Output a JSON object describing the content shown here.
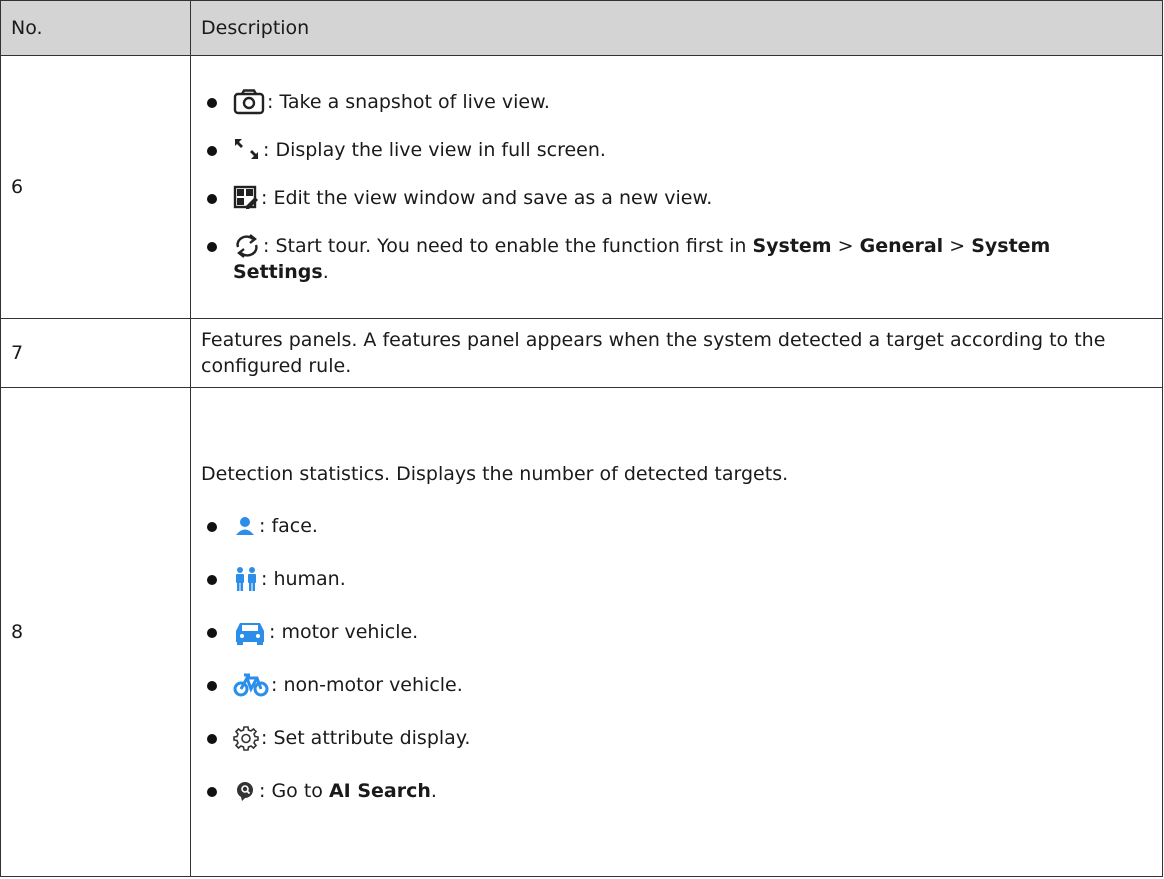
{
  "header": {
    "col_no": "No.",
    "col_desc": "Description"
  },
  "rows": {
    "r6": {
      "no": "6",
      "items": [
        {
          "icon": "camera-snapshot-icon",
          "text": ": Take a snapshot of live view."
        },
        {
          "icon": "fullscreen-icon",
          "text": ": Display the live view in full screen."
        },
        {
          "icon": "edit-view-window-icon",
          "text": ": Edit the view window and save as a new view."
        },
        {
          "icon": "tour-refresh-icon",
          "text_a": ": Start tour. You need to enable the function first in ",
          "b1": "System",
          "sep1": "  > ",
          "b2": "General",
          "sep2": " > ",
          "b3": "System Settings",
          "end": "."
        }
      ]
    },
    "r7": {
      "no": "7",
      "text": "Features panels. A features panel appears when the system detected a target according to the configured rule."
    },
    "r8": {
      "no": "8",
      "intro": "Detection statistics. Displays the number of detected targets.",
      "items": [
        {
          "icon": "face-icon",
          "text": ": face."
        },
        {
          "icon": "human-icon",
          "text": ": human."
        },
        {
          "icon": "motor-vehicle-icon",
          "text": ": motor vehicle."
        },
        {
          "icon": "non-motor-vehicle-icon",
          "text": ": non-motor vehicle."
        },
        {
          "icon": "gear-icon",
          "text": ": Set attribute display."
        },
        {
          "icon": "ai-search-icon",
          "text_a": ": Go to ",
          "b1": "AI Search",
          "end": "."
        }
      ]
    }
  },
  "colors": {
    "header_bg": "#d4d4d4",
    "icon_blue": "#2b8ee8",
    "border": "#333333"
  }
}
